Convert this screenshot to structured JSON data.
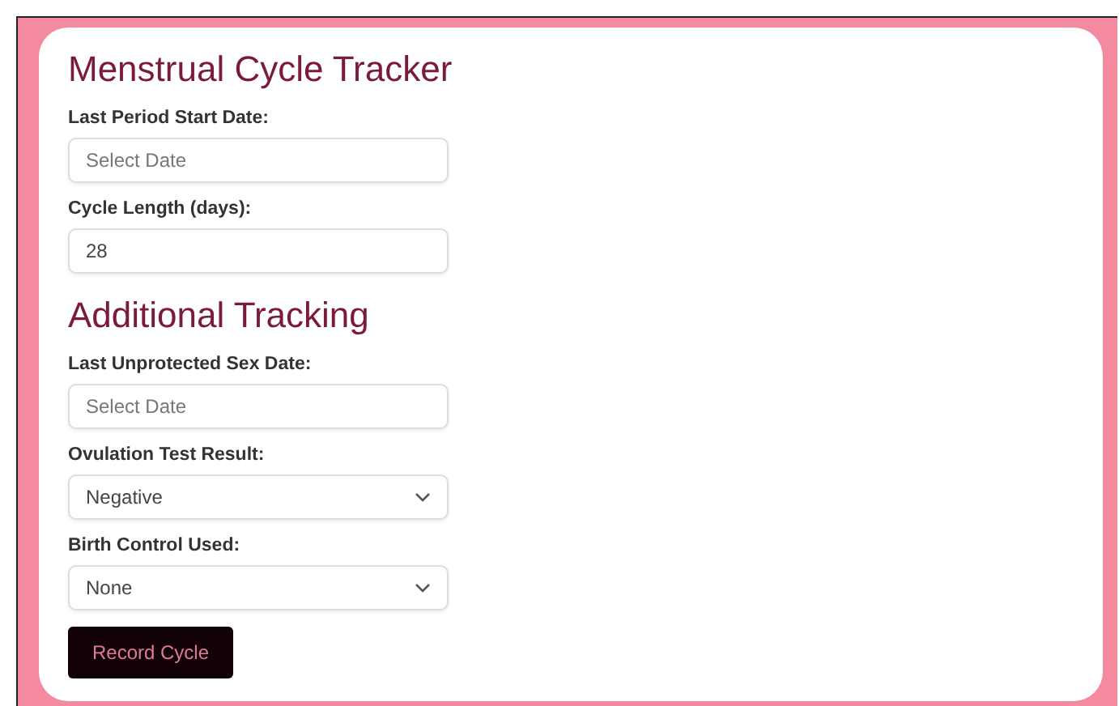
{
  "sections": [
    {
      "title": "Menstrual Cycle Tracker",
      "fields": [
        {
          "kind": "date",
          "label": "Last Period Start Date:",
          "placeholder": "Select Date"
        },
        {
          "kind": "number",
          "label": "Cycle Length (days):",
          "value": "28"
        }
      ]
    },
    {
      "title": "Additional Tracking",
      "fields": [
        {
          "kind": "date",
          "label": "Last Unprotected Sex Date:",
          "placeholder": "Select Date"
        },
        {
          "kind": "select",
          "label": "Ovulation Test Result:",
          "value": "Negative"
        },
        {
          "kind": "select",
          "label": "Birth Control Used:",
          "value": "None"
        }
      ]
    }
  ],
  "submit_button": "Record Cycle"
}
